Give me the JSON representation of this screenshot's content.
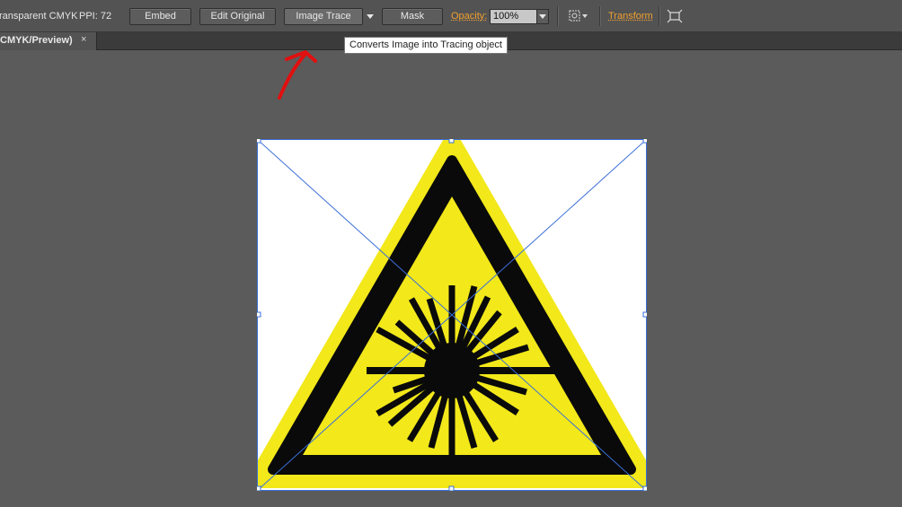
{
  "control_bar": {
    "image_info": "ransparent CMYK",
    "ppi": "PPI: 72",
    "embed_label": "Embed",
    "edit_original_label": "Edit Original",
    "image_trace_label": "Image Trace",
    "mask_label": "Mask",
    "opacity_label": "Opacity:",
    "opacity_value": "100%",
    "transform_label": "Transform"
  },
  "tab": {
    "title": "CMYK/Preview)",
    "close": "×"
  },
  "tooltip": {
    "text": "Converts Image into Tracing object"
  },
  "colors": {
    "canvas": "#5b5b5b",
    "sign_yellow": "#f2e81a",
    "sign_black": "#0a0a0a",
    "selection_blue": "#3a6fd8",
    "annotation_arrow": "#e01010",
    "link_orange": "#f0a030"
  }
}
